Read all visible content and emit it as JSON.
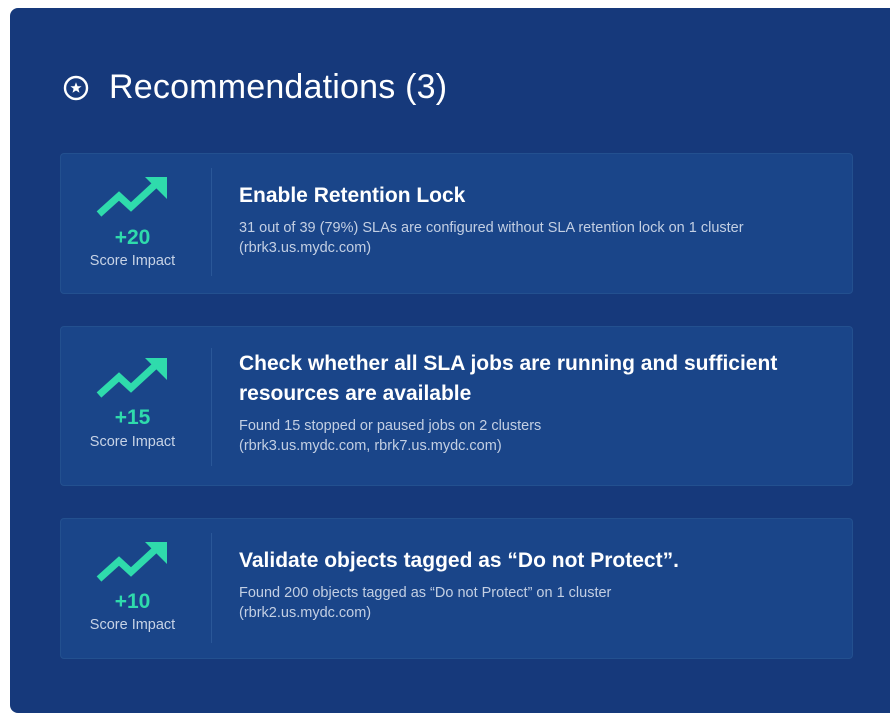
{
  "header": {
    "title": "Recommendations (3)",
    "icon": "star-circle-icon"
  },
  "colors": {
    "panel_background": "#16397b",
    "card_background": "#1a4589",
    "accent_green": "#2fdbac"
  },
  "recommendations": [
    {
      "score": "+20",
      "score_label": "Score Impact",
      "title": "Enable Retention Lock",
      "description_line1": "31 out of 39 (79%) SLAs are configured without SLA retention lock on 1 cluster",
      "description_line2": "(rbrk3.us.mydc.com)"
    },
    {
      "score": "+15",
      "score_label": "Score Impact",
      "title_line1": "Check whether all SLA jobs are running and sufficient",
      "title_line2": "resources are available",
      "description_line1": "Found 15 stopped or paused jobs on 2 clusters",
      "description_line2": "(rbrk3.us.mydc.com, rbrk7.us.mydc.com)"
    },
    {
      "score": "+10",
      "score_label": "Score Impact",
      "title": "Validate objects tagged as “Do not Protect”.",
      "description_line1": "Found 200 objects tagged as “Do not Protect” on 1 cluster",
      "description_line2": "(rbrk2.us.mydc.com)"
    }
  ]
}
